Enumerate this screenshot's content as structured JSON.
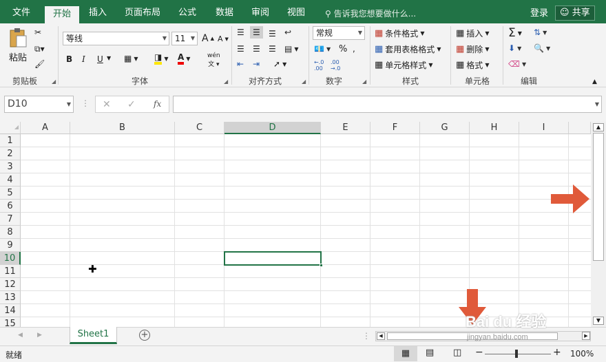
{
  "menu": {
    "tabs": [
      {
        "label": "文件"
      },
      {
        "label": "开始"
      },
      {
        "label": "插入"
      },
      {
        "label": "页面布局"
      },
      {
        "label": "公式"
      },
      {
        "label": "数据"
      },
      {
        "label": "审阅"
      },
      {
        "label": "视图"
      }
    ],
    "tell_me": "告诉我您想要做什么...",
    "login": "登录",
    "share": "共享"
  },
  "ribbon": {
    "clipboard": {
      "paste": "粘贴",
      "label": "剪贴板"
    },
    "font": {
      "name": "等线",
      "size": "11",
      "label": "字体",
      "bold": "B",
      "italic": "I",
      "underline": "U",
      "inc": "A",
      "dec": "A",
      "phonetic": "wén"
    },
    "align": {
      "label": "对齐方式"
    },
    "number": {
      "format": "常规",
      "label": "数字",
      "percent": "%"
    },
    "styles": {
      "cond": "条件格式",
      "table": "套用表格格式",
      "cell": "单元格样式",
      "label": "样式"
    },
    "cells": {
      "insert": "插入",
      "delete": "删除",
      "format": "格式",
      "label": "单元格"
    },
    "edit": {
      "label": "编辑"
    }
  },
  "formula": {
    "name_box": "D10",
    "fx": "fx",
    "value": ""
  },
  "columns": [
    "A",
    "B",
    "C",
    "D",
    "E",
    "F",
    "G",
    "H",
    "I"
  ],
  "rows": [
    "1",
    "2",
    "3",
    "4",
    "5",
    "6",
    "7",
    "8",
    "9",
    "10",
    "11",
    "12",
    "13",
    "14",
    "15"
  ],
  "sheet": {
    "tab": "Sheet1"
  },
  "status": {
    "text": "就绪",
    "zoom": "100%"
  },
  "watermark": {
    "brand": "Bai du 经验",
    "url": "jingyan.baidu.com"
  },
  "colors": {
    "accent": "#217346",
    "arrow": "#e05a3a"
  }
}
